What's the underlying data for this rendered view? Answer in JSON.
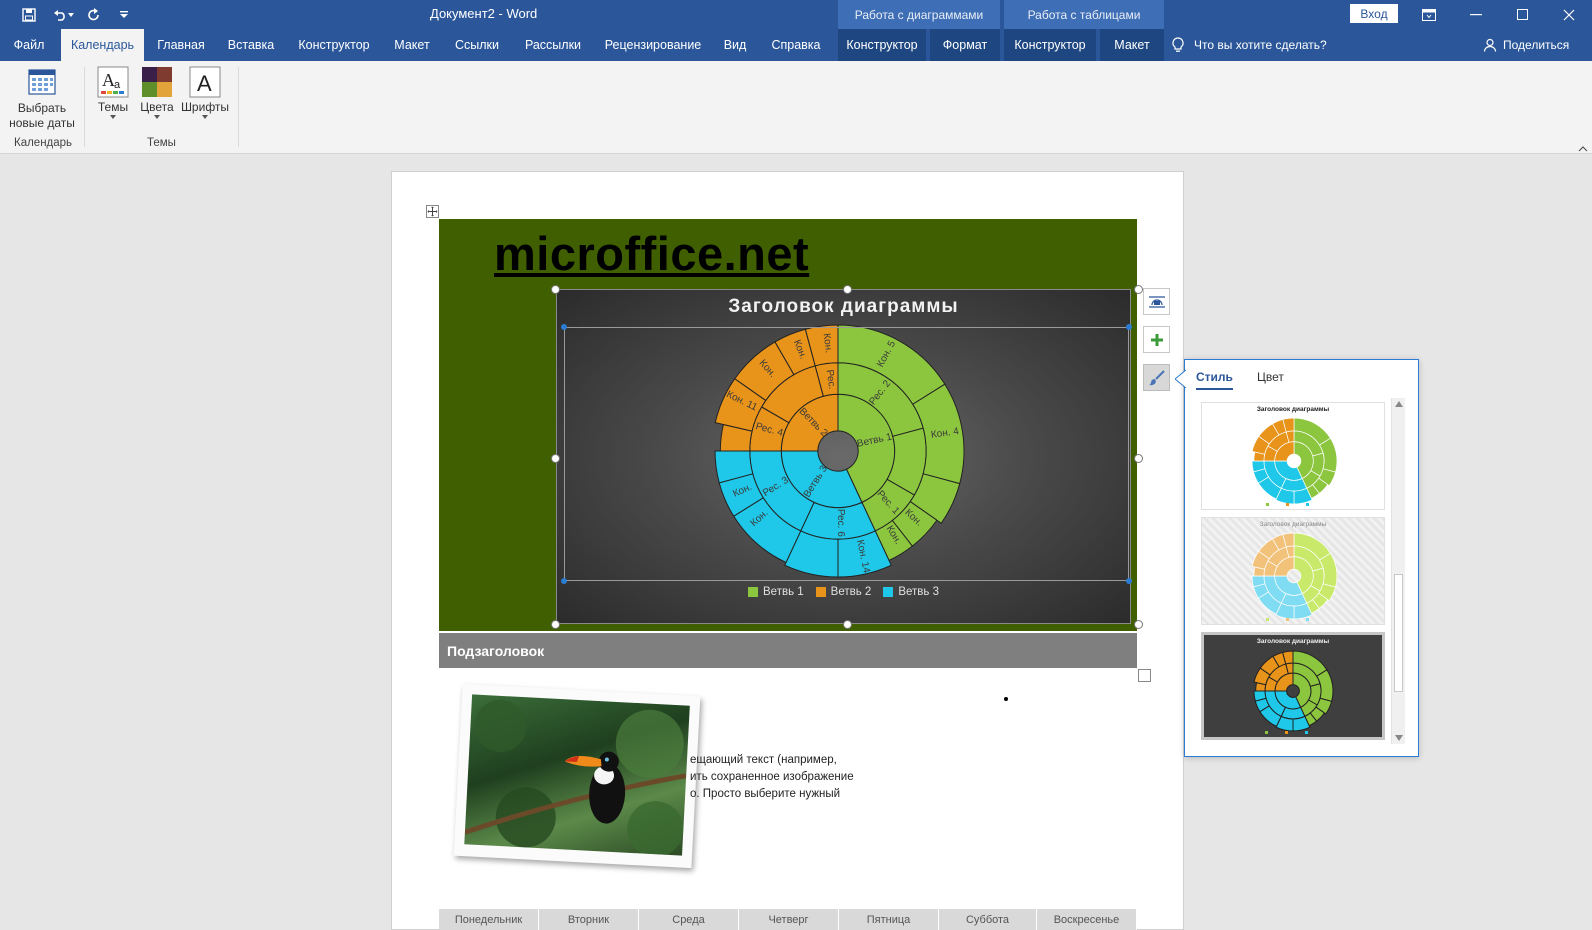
{
  "titlebar": {
    "doc_title": "Документ2 - Word",
    "context_headers": [
      "Работа с диаграммами",
      "Работа с таблицами"
    ],
    "login_label": "Вход"
  },
  "ribbon_tabs": [
    {
      "label": "Файл"
    },
    {
      "label": "Календарь",
      "active": true
    },
    {
      "label": "Главная"
    },
    {
      "label": "Вставка"
    },
    {
      "label": "Конструктор"
    },
    {
      "label": "Макет"
    },
    {
      "label": "Ссылки"
    },
    {
      "label": "Рассылки"
    },
    {
      "label": "Рецензирование"
    },
    {
      "label": "Вид"
    },
    {
      "label": "Справка"
    },
    {
      "label": "Конструктор"
    },
    {
      "label": "Формат"
    },
    {
      "label": "Конструктор"
    },
    {
      "label": "Макет"
    }
  ],
  "tell_me": "Что вы хотите сделать?",
  "share": "Поделиться",
  "ribbon": {
    "new_dates_line1": "Выбрать",
    "new_dates_line2": "новые даты",
    "themes": "Темы",
    "colors": "Цвета",
    "fonts": "Шрифты",
    "group_calendar": "Календарь",
    "group_themes": "Темы"
  },
  "document": {
    "site_title": "microffice.net",
    "subheader": "Подзаголовок",
    "body_lines": [
      "ещающий текст (например,",
      "ить сохраненное изображение",
      "о. Просто выберите нужный"
    ],
    "weekdays": [
      "Понедельник",
      "Вторник",
      "Среда",
      "Четверг",
      "Пятница",
      "Суббота",
      "Воскресенье"
    ]
  },
  "style_pane": {
    "tab_style": "Стиль",
    "tab_color": "Цвет",
    "thumb_title": "Заголовок диаграммы"
  },
  "colors": {
    "branch1": "#8cc63f",
    "branch2": "#e8931a",
    "branch3": "#1fc8e8",
    "accent": "#2b579a"
  },
  "chart_data": {
    "type": "sunburst",
    "title": "Заголовок диаграммы",
    "legend": [
      "Ветвь 1",
      "Ветвь 2",
      "Ветвь 3"
    ],
    "legend_position": "bottom",
    "inner_ring_labels": [
      "Ветвь 1",
      "Ветвь 3",
      "Ветвь 2"
    ],
    "middle_ring_labels": [
      "Рес. 2",
      "Рес. 1",
      "Рес. 6",
      "Рес. 3",
      "Рес. 4",
      "Рес."
    ],
    "outer_ring_labels": [
      "Кон. 5",
      "Кон. 4",
      "Кон.",
      "Кон.",
      "Кон. 14",
      "Кон.",
      "Кон.",
      "Кон. 11",
      "Кон.",
      "Кон.",
      "Кон."
    ]
  }
}
